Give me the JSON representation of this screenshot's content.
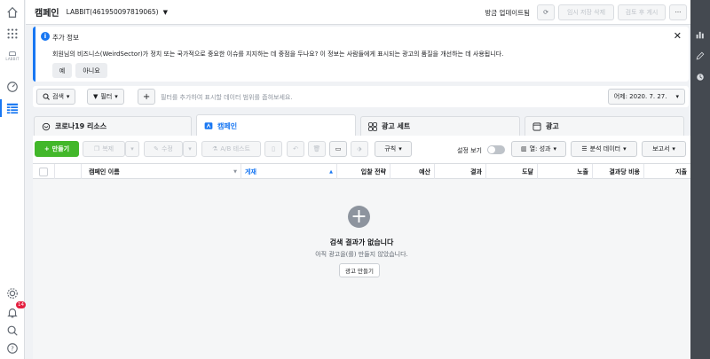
{
  "rail": {
    "logo_text": "LABBIT",
    "notification_count": "14"
  },
  "topbar": {
    "title": "캠페인",
    "account": "LABBIT(461950097819065)",
    "update_text": "방금 업데이트됨",
    "discard_label": "임시 저장 삭제",
    "review_label": "검토 후 게시",
    "more_label": "···"
  },
  "banner": {
    "title": "추가 정보",
    "text": "회원님의 비즈니스(WeirdSector)가 정치 또는 국가적으로 중요한 이슈를 지지하는 데 중점을 두나요? 이 정보는 사람들에게 표시되는 광고의 품질을 개선하는 데 사용됩니다.",
    "yes_label": "예",
    "no_label": "아니요"
  },
  "search": {
    "search_label": "검색",
    "filter_label": "필터",
    "placeholder": "필터를 추가하여 표시할 데이터 범위를 좁혀보세요.",
    "date_label": "어제: 2020. 7. 27."
  },
  "tabs": [
    {
      "label": "코로나19 리소스"
    },
    {
      "label": "캠페인"
    },
    {
      "label": "광고 세트"
    },
    {
      "label": "광고"
    }
  ],
  "toolbar": {
    "create_label": "만들기",
    "duplicate_label": "복제",
    "edit_label": "수정",
    "ab_test_label": "A/B 테스트",
    "rules_label": "규칙",
    "settings_label": "설정 보기",
    "columns_label": "열: 성과",
    "breakdown_label": "분석 데이터",
    "reports_label": "보고서"
  },
  "table": {
    "columns": [
      "캠페인 이름",
      "게재",
      "입찰 전략",
      "예산",
      "결과",
      "도달",
      "노출",
      "결과당 비용",
      "지출"
    ]
  },
  "empty": {
    "title": "검색 결과가 없습니다",
    "subtitle": "아직 광고을(를) 만들지 않았습니다.",
    "button_label": "광고 만들기"
  }
}
